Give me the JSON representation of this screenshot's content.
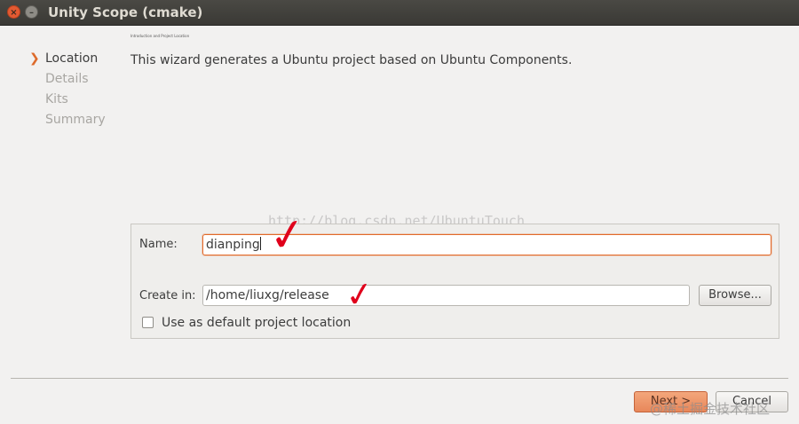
{
  "window": {
    "title": "Unity Scope (cmake)",
    "close_glyph": "×",
    "minimize_glyph": "–"
  },
  "wizard": {
    "subheading": "Introduction and Project Location",
    "intro": "This wizard generates a Ubuntu project based on Ubuntu Components.",
    "steps": [
      {
        "label": "Location",
        "active": true
      },
      {
        "label": "Details",
        "active": false
      },
      {
        "label": "Kits",
        "active": false
      },
      {
        "label": "Summary",
        "active": false
      }
    ]
  },
  "watermark": "http://blog.csdn.net/UbuntuTouch",
  "form": {
    "name_label": "Name:",
    "name_value": "dianping",
    "create_in_label": "Create in:",
    "create_in_value": "/home/liuxg/release",
    "browse_label": "Browse...",
    "default_location_label": "Use as default project location",
    "default_location_checked": false
  },
  "footer": {
    "next_label": "Next >",
    "cancel_label": "Cancel",
    "corner_watermark": "@稀土掘金技术社区"
  },
  "colors": {
    "accent": "#dd6a2b",
    "annotation": "#e0001b",
    "titlebar": "#3c3b37"
  }
}
